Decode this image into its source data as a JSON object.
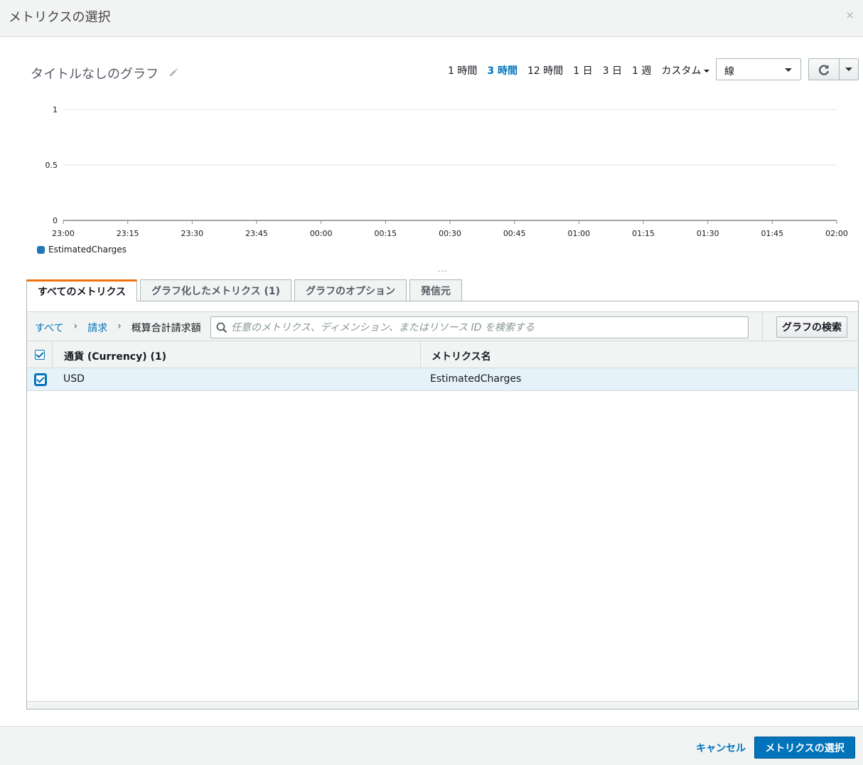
{
  "dialog": {
    "title": "メトリクスの選択",
    "close_label": "×"
  },
  "graph": {
    "title": "タイトルなしのグラフ",
    "ranges": [
      "1 時間",
      "3 時間",
      "12 時間",
      "1 日",
      "3 日",
      "1 週"
    ],
    "active_range": "3 時間",
    "custom_label": "カスタム",
    "chart_type_selected": "線"
  },
  "chart_data": {
    "type": "line",
    "x_ticks": [
      "23:00",
      "23:15",
      "23:30",
      "23:45",
      "00:00",
      "00:15",
      "00:30",
      "00:45",
      "01:00",
      "01:15",
      "01:30",
      "01:45",
      "02:00"
    ],
    "y_ticks": [
      "1",
      "0.5",
      "0"
    ],
    "ylim": [
      0,
      1
    ],
    "series": [
      {
        "name": "EstimatedCharges",
        "color": "#1f77b4",
        "values": []
      }
    ],
    "legend": "bottom-left",
    "grid": true
  },
  "divider_handle": "---",
  "tabs": [
    {
      "label": "すべてのメトリクス",
      "active": true
    },
    {
      "label": "グラフ化したメトリクス (1)",
      "active": false
    },
    {
      "label": "グラフのオプション",
      "active": false
    },
    {
      "label": "発信元",
      "active": false
    }
  ],
  "breadcrumb": {
    "all": "すべて",
    "billing": "請求",
    "current": "概算合計請求額"
  },
  "search": {
    "placeholder": "任意のメトリクス、ディメンション、またはリソース ID を検索する",
    "value": ""
  },
  "graph_search_label": "グラフの検索",
  "table": {
    "columns": [
      "通貨 (Currency) (1)",
      "メトリクス名"
    ],
    "rows": [
      {
        "currency": "USD",
        "metric": "EstimatedCharges",
        "checked": true
      }
    ]
  },
  "footer": {
    "cancel_label": "キャンセル",
    "submit_label": "メトリクスの選択"
  },
  "colors": {
    "accent": "#0073bb",
    "tab_active": "#ec7211",
    "series": "#1f77b4"
  }
}
